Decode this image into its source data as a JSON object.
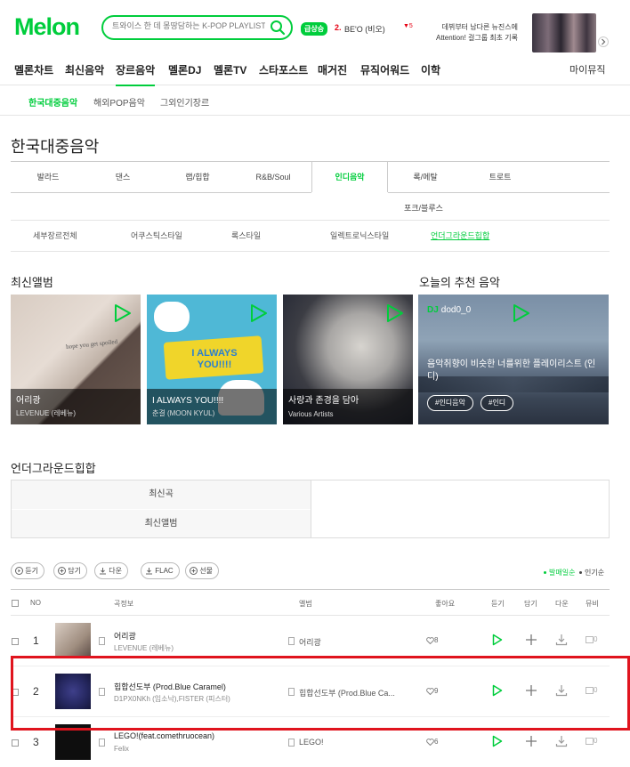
{
  "header": {
    "logo": "Melon",
    "search_placeholder": "트와이스 한 데 몽땅담하는 K-POP PLAYLIST",
    "realtime_badge": "급상승",
    "rank_num": "2.",
    "rank_name": "BE'O (비오)",
    "rank_change": "▼5",
    "promo_line1": "데뷔부터 남다른 뉴진스에",
    "promo_line2": "Attention! 걸그룹 최초 기록"
  },
  "gnb": {
    "items": [
      "멜론차트",
      "최신음악",
      "장르음악",
      "멜론DJ",
      "멜론TV",
      "스타포스트",
      "매거진",
      "뮤직어워드",
      "이학"
    ],
    "my": "마이뮤직"
  },
  "subnav": [
    "한국대중음악",
    "해외POP음악",
    "그외인기장르"
  ],
  "page_title": "한국대중음악",
  "genres": {
    "row1": [
      "발라드",
      "댄스",
      "랩/힙합",
      "R&B/Soul",
      "인디음악",
      "록/메탈",
      "트로트"
    ],
    "row2": [
      "포크/블루스"
    ],
    "row3": [
      "세부장르전체",
      "어쿠스틱스타일",
      "록스타일",
      "일렉트로닉스타일",
      "언더그라운드힙합"
    ]
  },
  "latest": {
    "title": "최신앨범",
    "albums": [
      {
        "title": "어리광",
        "artist": "LEVENUE (레베뉴)",
        "cover_text": "hope you get spoiled"
      },
      {
        "title": "I ALWAYS YOU!!!!",
        "artist": "춘결 (MOON KYUL)",
        "cover_text": "I ALWAYS YOU!!!!"
      },
      {
        "title": "사랑과 존경을 담아",
        "artist": "Various Artists"
      }
    ]
  },
  "recommend": {
    "title": "오늘의 추천 음악",
    "dj_badge": "DJ",
    "dj_name": "dod0_0",
    "text": "음악취향이 비슷한 너를위한 플레이리스트 (인디)",
    "tags": [
      "#인디음악",
      "#인디"
    ]
  },
  "underground": {
    "title": "언더그라운드힙합",
    "tabs": [
      "최신곡",
      "최신앨범"
    ]
  },
  "toolbar": {
    "buttons": [
      "듣기",
      "담기",
      "다운",
      "FLAC",
      "선물"
    ],
    "sort_active": "발매일순",
    "sort_other": "인기순"
  },
  "table": {
    "headers": {
      "no": "NO",
      "song": "곡정보",
      "album": "앨범",
      "like": "좋아요",
      "listen": "듣기",
      "add": "담기",
      "down": "다운",
      "mv": "뮤비"
    },
    "rows": [
      {
        "rank": "1",
        "song": "어리광",
        "artist": "LEVENUE (레베뉴)",
        "album": "어리광",
        "likes": "8",
        "mv": "0"
      },
      {
        "rank": "2",
        "song": "힙합선도부 (Prod.Blue Caramel)",
        "artist": "D1PX0NKh (임소낙),FISTER (피스터)",
        "album": "힙합선도부 (Prod.Blue Ca...",
        "likes": "9",
        "mv": "0"
      },
      {
        "rank": "3",
        "song": "LEGO!(feat.comethruocean)",
        "artist": "Felix",
        "album": "LEGO!",
        "likes": "6",
        "mv": "0"
      }
    ]
  },
  "colors": {
    "brand": "#00cd3c",
    "highlight": "#e0141e"
  }
}
